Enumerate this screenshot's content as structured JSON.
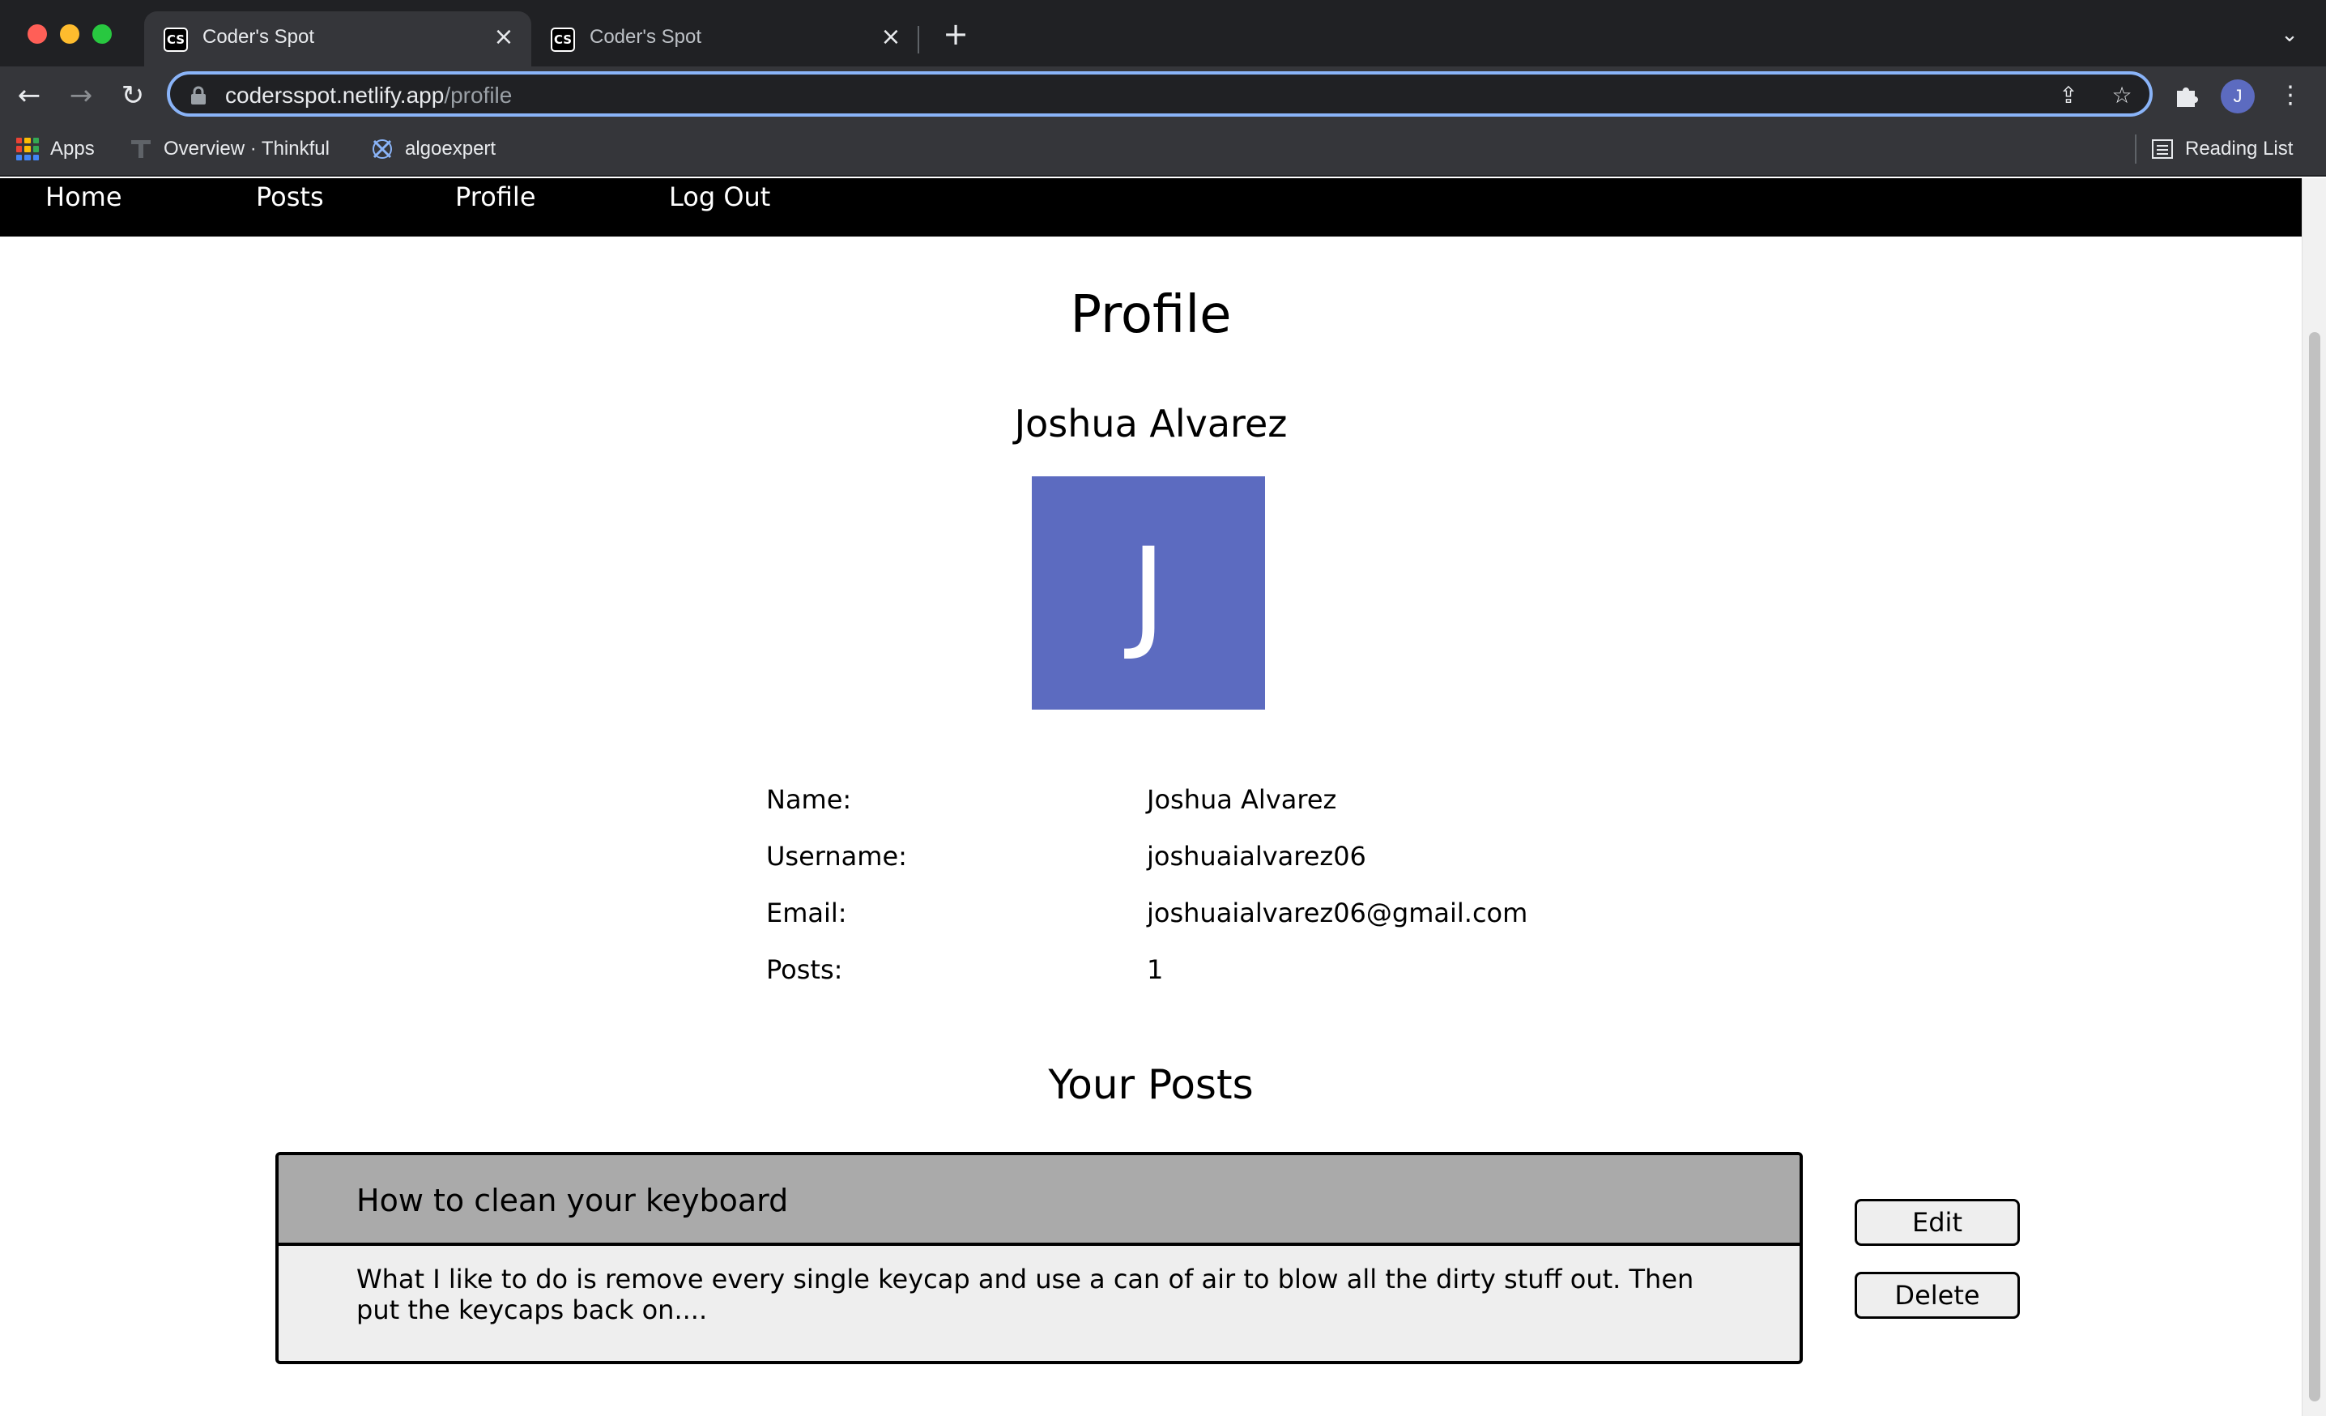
{
  "browser": {
    "tabs": [
      {
        "favicon": "CS",
        "title": "Coder's Spot",
        "active": true
      },
      {
        "favicon": "CS",
        "title": "Coder's Spot",
        "active": false
      }
    ],
    "url_domain": "codersspot.netlify.app",
    "url_path": "/profile",
    "profile_initial": "J",
    "bookmarks": [
      {
        "label": "Apps",
        "icon": "apps-grid-icon"
      },
      {
        "label": "Overview · Thinkful",
        "icon": "thinkful-icon"
      },
      {
        "label": "algoexpert",
        "icon": "algoexpert-icon"
      }
    ],
    "reading_list": "Reading List"
  },
  "nav": {
    "home": "Home",
    "posts": "Posts",
    "profile": "Profile",
    "logout": "Log Out"
  },
  "profile": {
    "title": "Profile",
    "name": "Joshua Alvarez",
    "avatar_initial": "J",
    "avatar_color": "#5c6bc0",
    "info": [
      {
        "label": "Name:",
        "value": "Joshua Alvarez"
      },
      {
        "label": "Username:",
        "value": "joshuaialvarez06"
      },
      {
        "label": "Email:",
        "value": "joshuaialvarez06@gmail.com"
      },
      {
        "label": "Posts:",
        "value": "1"
      }
    ]
  },
  "posts_section": {
    "title": "Your Posts",
    "posts": [
      {
        "title": "How to clean your keyboard",
        "body": "What I like to do is remove every single keycap and use a can of air to blow all the dirty stuff out. Then put the keycaps back on....",
        "edit_label": "Edit",
        "delete_label": "Delete"
      }
    ]
  }
}
